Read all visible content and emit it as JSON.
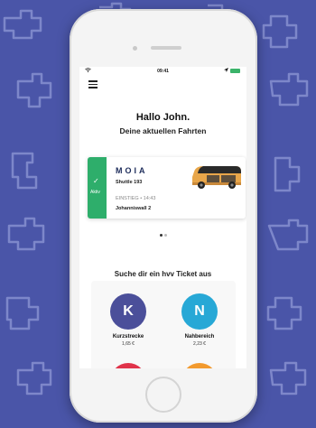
{
  "colors": {
    "background": "#4a55a8",
    "active_green": "#2eae6b",
    "kurzstrecke": "#4b4f9a",
    "nahbereich": "#27a8d6",
    "third_ticket": "#e0334a",
    "fourth_ticket": "#f29a2e",
    "moia_navy": "#1c2b5a"
  },
  "status_bar": {
    "time": "09:41",
    "wifi_icon": "wifi-icon",
    "location_icon": "location-arrow-icon",
    "battery_icon": "battery-icon"
  },
  "header": {
    "menu_icon": "hamburger-menu-icon",
    "greeting": "Hallo John.",
    "subtitle": "Deine aktuellen Fahrten"
  },
  "ride": {
    "status_label": "Aktiv",
    "status_icon": "check-icon",
    "brand": "MOIA",
    "vehicle": "Shuttle 193",
    "pickup": "EINSTIEG • 14:43",
    "stop": "Johanniswall 2",
    "image_icon": "shuttle-van-icon"
  },
  "carousel": {
    "pages": 2,
    "active": 1
  },
  "tickets": {
    "title": "Suche dir ein hvv Ticket aus",
    "items": [
      {
        "letter": "K",
        "name": "Kurzstrecke",
        "price": "1,65 €"
      },
      {
        "letter": "N",
        "name": "Nahbereich",
        "price": "2,23 €"
      }
    ]
  }
}
